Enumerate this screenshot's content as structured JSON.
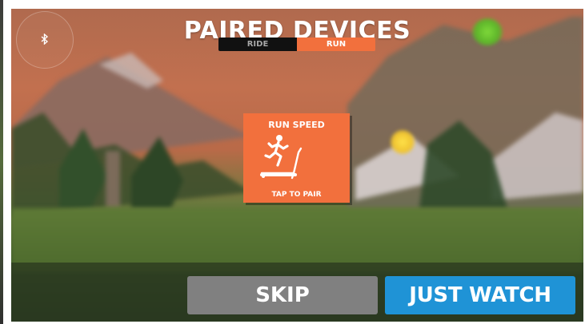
{
  "header": {
    "title": "PAIRED DEVICES",
    "modes": [
      {
        "label": "RIDE",
        "selected": false
      },
      {
        "label": "RUN",
        "selected": true
      }
    ]
  },
  "bluetooth": {
    "icon": "bluetooth-icon"
  },
  "device_tile": {
    "title": "RUN SPEED",
    "icon": "treadmill-runner-icon",
    "action": "TAP TO PAIR"
  },
  "actions": {
    "skip_label": "SKIP",
    "just_watch_label": "JUST WATCH"
  },
  "colors": {
    "accent_orange": "#f2703d",
    "primary_blue": "#1f93d6",
    "secondary_gray": "#808080",
    "toggle_dark": "#111111"
  }
}
